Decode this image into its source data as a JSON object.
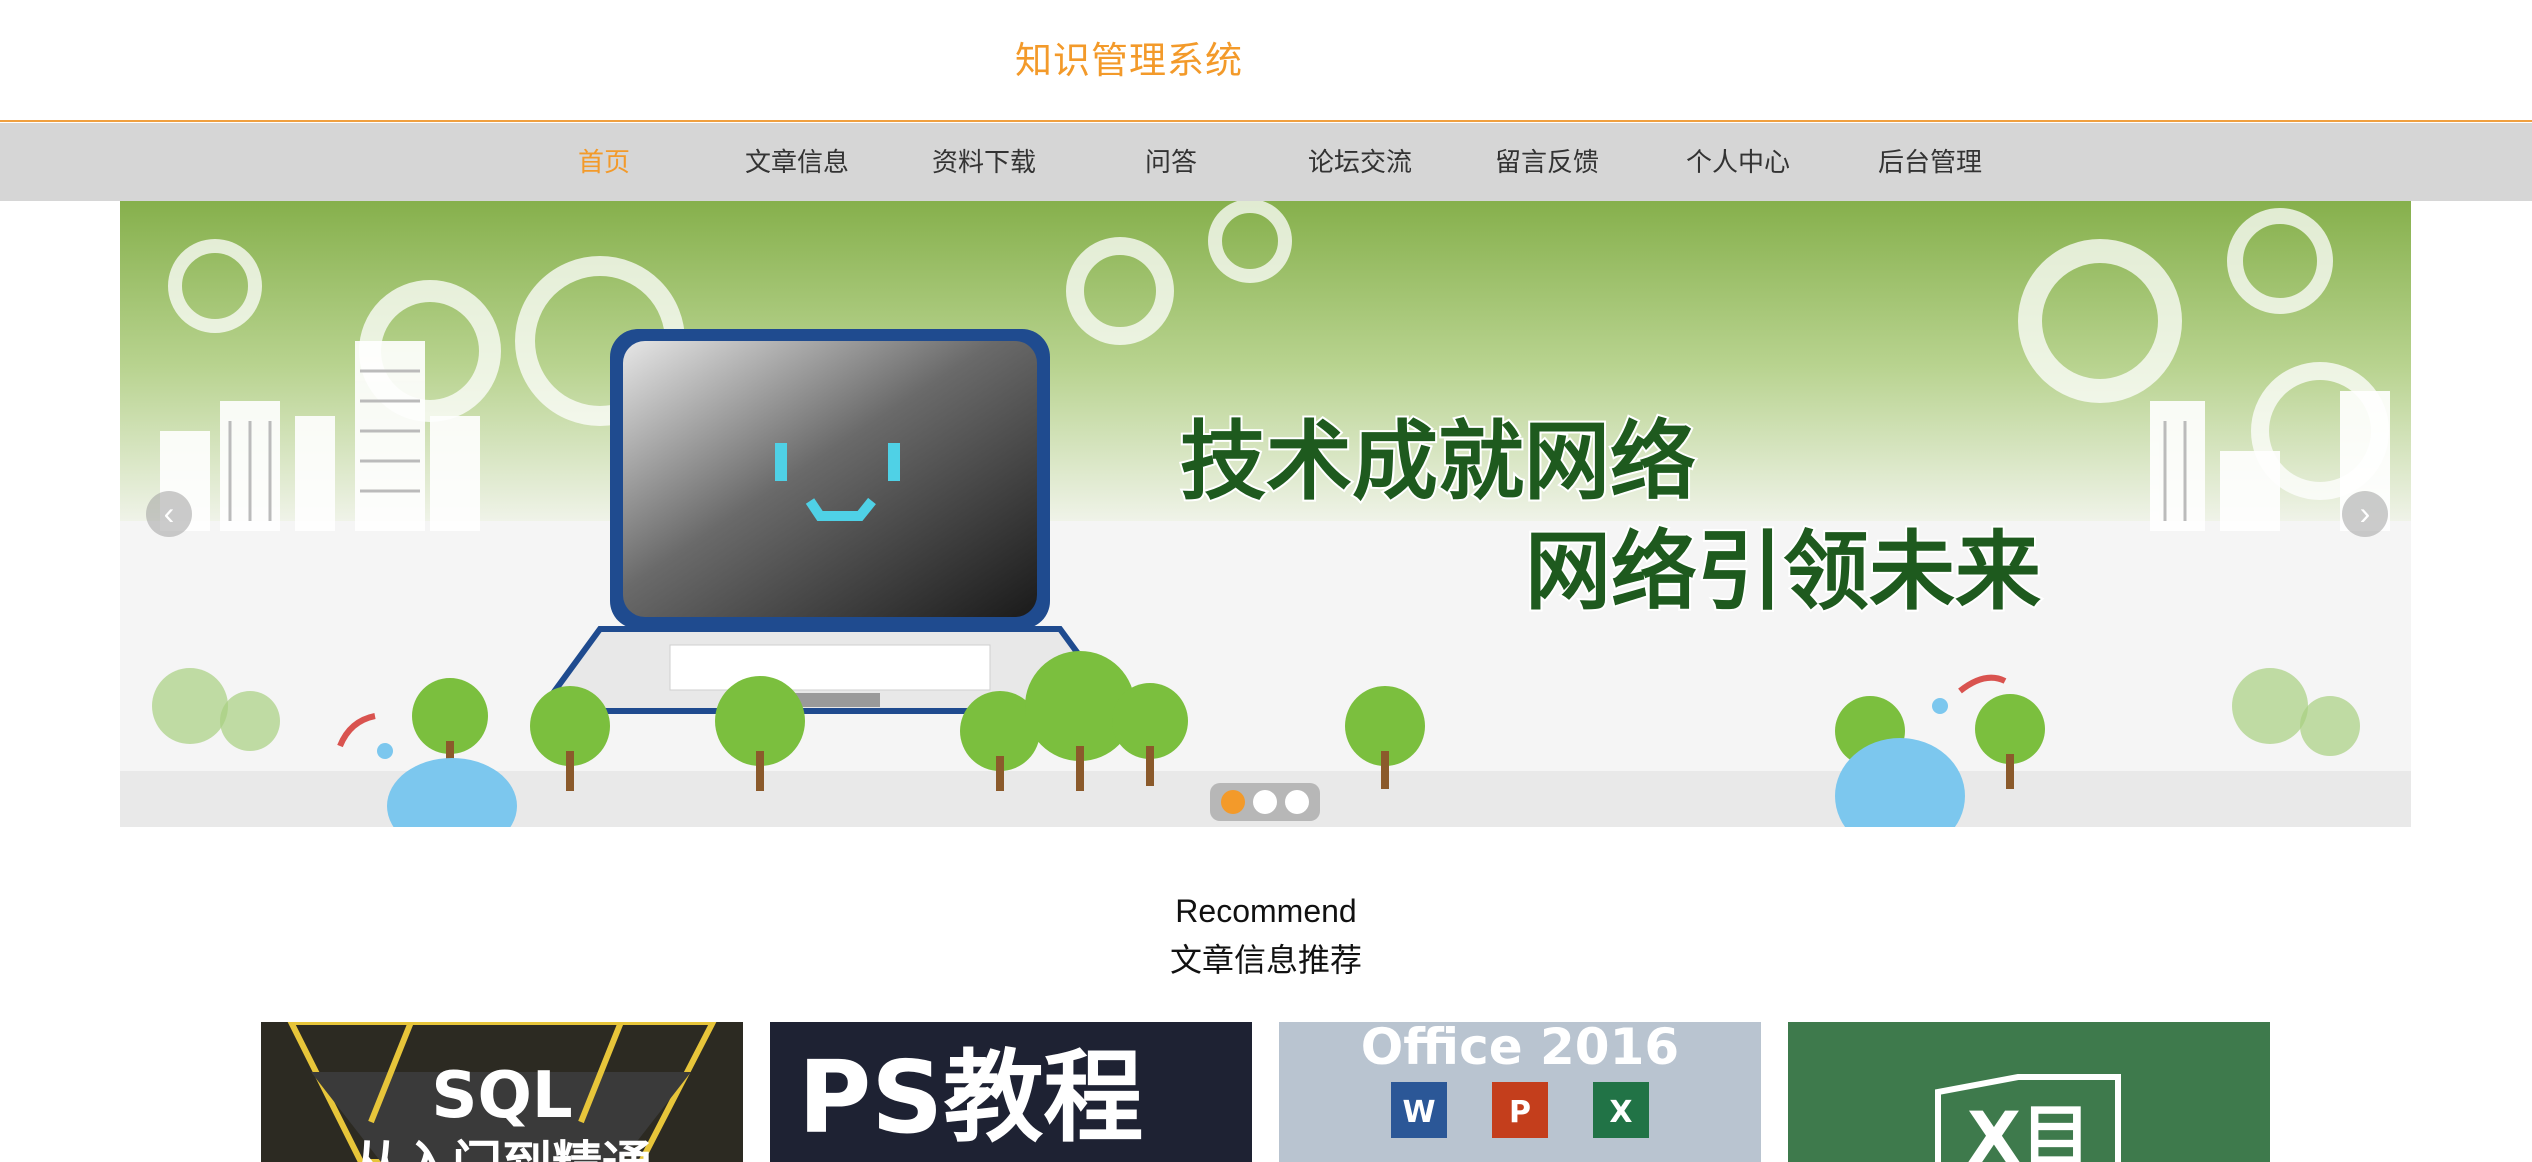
{
  "header": {
    "title": "知识管理系统"
  },
  "nav": {
    "items": [
      {
        "label": "首页",
        "active": true
      },
      {
        "label": "文章信息",
        "active": false
      },
      {
        "label": "资料下载",
        "active": false
      },
      {
        "label": "问答",
        "active": false
      },
      {
        "label": "论坛交流",
        "active": false
      },
      {
        "label": "留言反馈",
        "active": false
      },
      {
        "label": "个人中心",
        "active": false
      },
      {
        "label": "后台管理",
        "active": false
      }
    ]
  },
  "banner": {
    "line1": "技术成就网络",
    "line2": "网络引领未来",
    "slides": 3,
    "active_slide": 1,
    "prev_icon": "chevron-left-icon",
    "next_icon": "chevron-right-icon"
  },
  "recommend": {
    "title_en": "Recommend",
    "title_cn": "文章信息推荐",
    "cards": [
      {
        "text": "SQL",
        "subtext": "从入门到精通"
      },
      {
        "text": "PS教程",
        "subtext": ""
      },
      {
        "text": "Office 2016",
        "subtext": ""
      },
      {
        "text": "X目",
        "subtext": ""
      }
    ]
  },
  "colors": {
    "accent": "#f39a2a",
    "nav_bg": "#d6d6d6",
    "banner_green": "#8db55a"
  }
}
